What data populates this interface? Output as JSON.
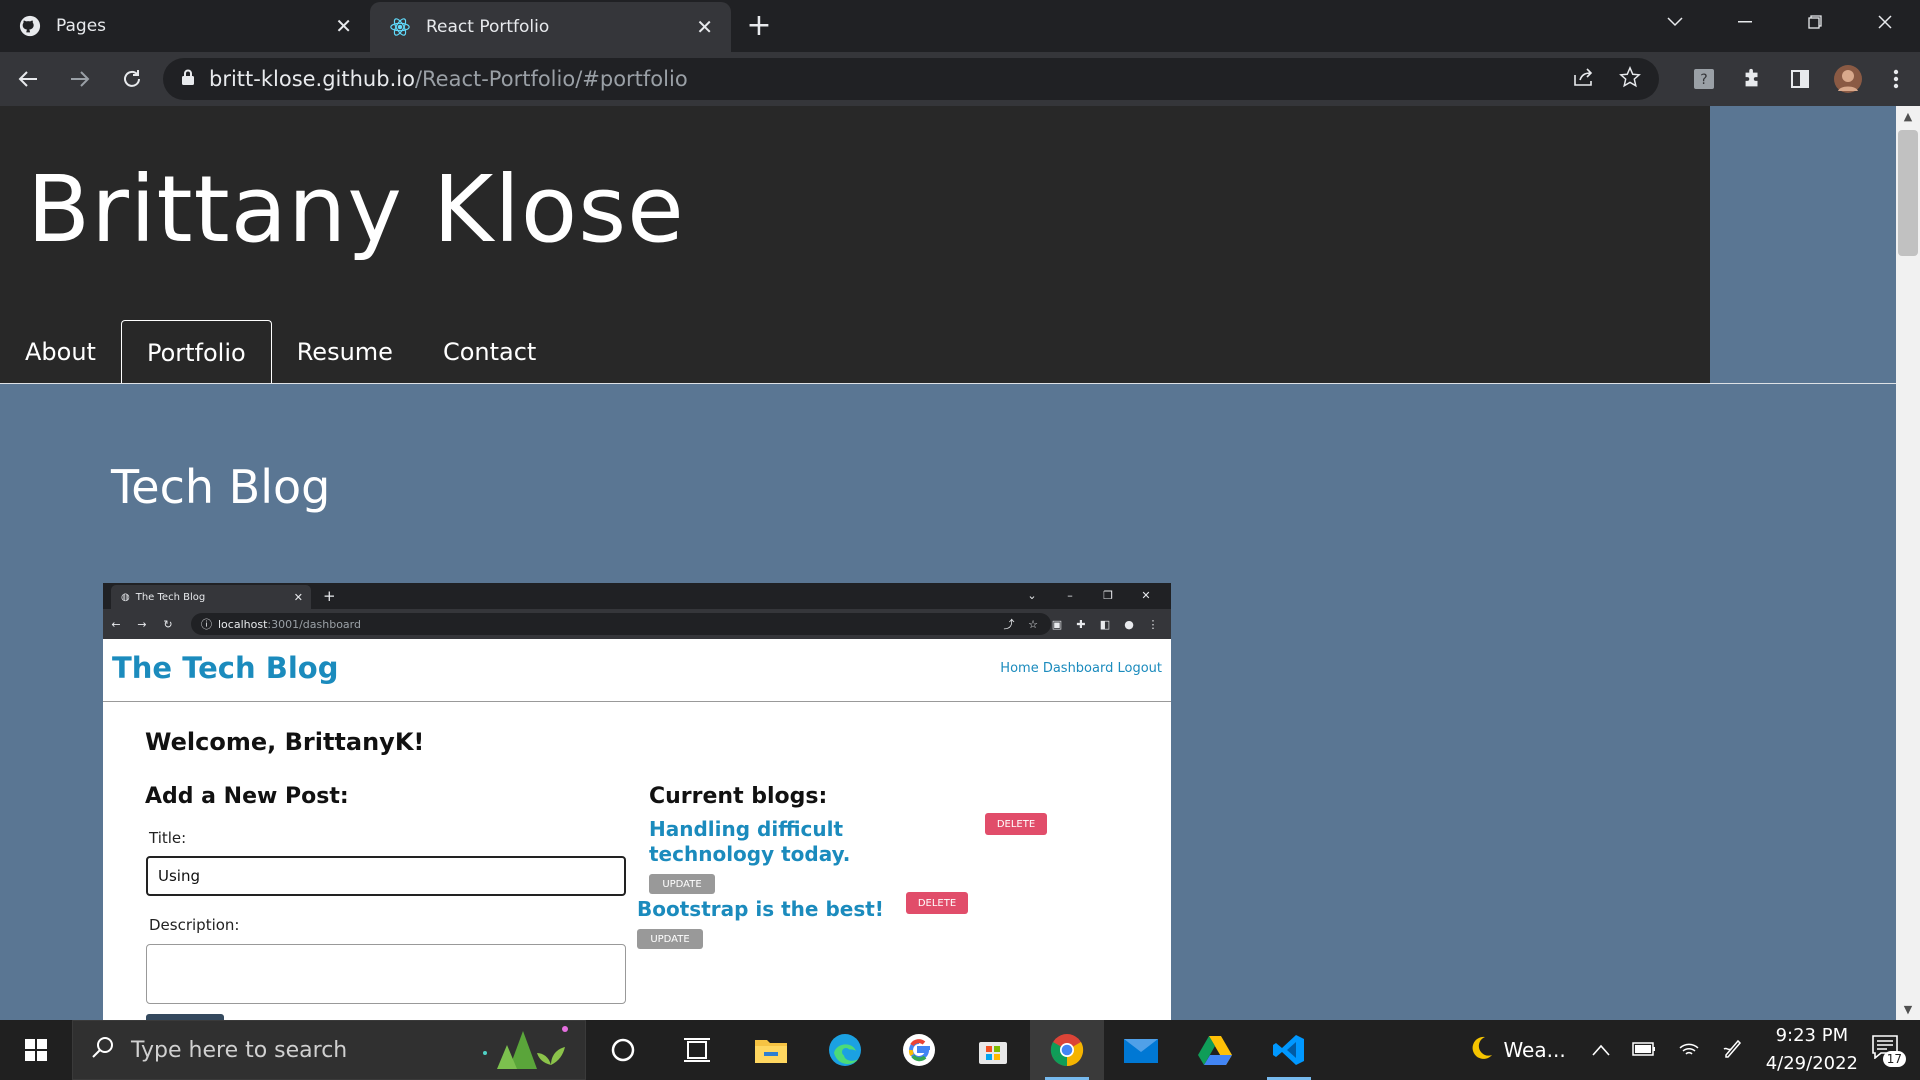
{
  "browser": {
    "tabs": [
      {
        "title": "Pages",
        "icon": "github-icon"
      },
      {
        "title": "React Portfolio",
        "icon": "react-icon",
        "active": true
      }
    ],
    "url_host": "britt-klose.github.io",
    "url_path": "/React-Portfolio/#portfolio"
  },
  "site": {
    "brand": "Brittany Klose",
    "nav": [
      "About",
      "Portfolio",
      "Resume",
      "Contact"
    ],
    "active_nav": "Portfolio",
    "section_title": "Tech Blog"
  },
  "screenshot": {
    "tab_title": "The Tech Blog",
    "url_host": "localhost",
    "url_path": ":3001/dashboard",
    "logo": "The Tech Blog",
    "links": "Home Dashboard Logout",
    "welcome": "Welcome, BrittanyK!",
    "add_heading": "Add a New Post:",
    "title_label": "Title:",
    "title_value": "Using",
    "desc_label": "Description:",
    "current_heading": "Current blogs:",
    "posts": [
      {
        "title": "Handling difficult technology today.",
        "delete": "DELETE",
        "update": "UPDATE"
      },
      {
        "title": "Bootstrap is the best!",
        "delete": "DELETE",
        "update": "UPDATE"
      }
    ]
  },
  "taskbar": {
    "search_placeholder": "Type here to search",
    "weather": "Wea...",
    "time": "9:23 PM",
    "date": "4/29/2022",
    "notifications": "17"
  }
}
